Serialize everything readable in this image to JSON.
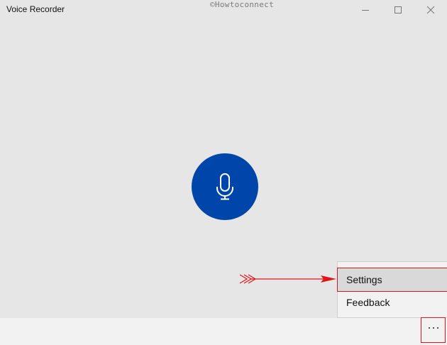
{
  "window": {
    "title": "Voice Recorder",
    "watermark": "©Howtoconnect"
  },
  "controls": {
    "minimize": "minimize-icon",
    "maximize": "maximize-icon",
    "close": "close-icon"
  },
  "record": {
    "icon": "microphone-icon",
    "color": "#0046aa"
  },
  "menu": {
    "items": [
      {
        "label": "Settings"
      },
      {
        "label": "Feedback"
      }
    ]
  },
  "bottom_bar": {
    "more_icon": "more-options-icon"
  },
  "annotation": {
    "color": "#e0141c"
  }
}
